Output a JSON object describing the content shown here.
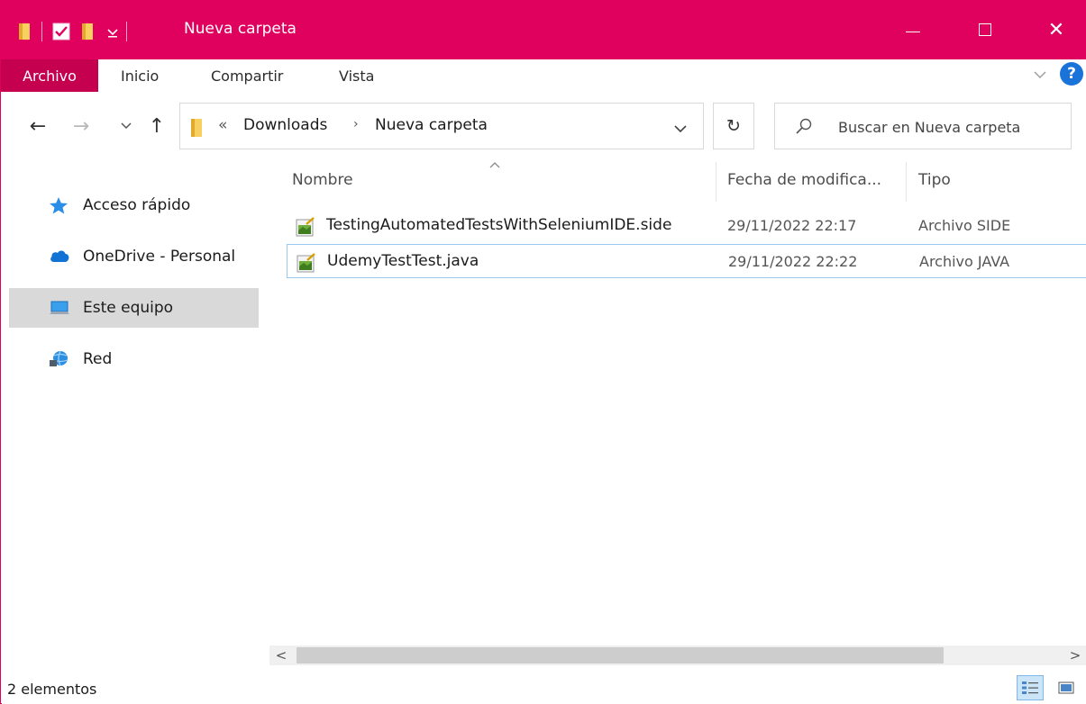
{
  "window": {
    "title": "Nueva carpeta",
    "accent_color": "#e0005e",
    "controls": {
      "minimize": "minimize-icon",
      "maximize": "maximize-icon",
      "close": "✕"
    }
  },
  "ribbon": {
    "tabs": [
      "Archivo",
      "Inicio",
      "Compartir",
      "Vista"
    ],
    "help_label": "?"
  },
  "navigation": {
    "back_icon": "←",
    "forward_icon": "→",
    "recent_icon": "˅",
    "up_icon": "↑",
    "breadcrumb": {
      "overflow": "«",
      "items": [
        "Downloads",
        "Nueva carpeta"
      ],
      "separator": "›"
    },
    "refresh_icon": "↻",
    "search_placeholder": "Buscar en Nueva carpeta"
  },
  "sidebar": {
    "items": [
      {
        "label": "Acceso rápido",
        "icon": "star-icon"
      },
      {
        "label": "OneDrive - Personal",
        "icon": "cloud-icon"
      },
      {
        "label": "Este equipo",
        "icon": "computer-icon",
        "selected": true
      },
      {
        "label": "Red",
        "icon": "network-icon"
      }
    ]
  },
  "file_list": {
    "columns": {
      "name": "Nombre",
      "date": "Fecha de modifica...",
      "type": "Tipo"
    },
    "sort_indicator": "^",
    "rows": [
      {
        "name": "TestingAutomatedTestsWithSeleniumIDE.side",
        "date": "29/11/2022 22:17",
        "type": "Archivo SIDE"
      },
      {
        "name": "UdemyTestTest.java",
        "date": "29/11/2022 22:22",
        "type": "Archivo JAVA",
        "selected": true
      }
    ]
  },
  "scrollbar": {
    "left_arrow": "<",
    "right_arrow": ">"
  },
  "status_bar": {
    "item_count": "2 elementos"
  }
}
